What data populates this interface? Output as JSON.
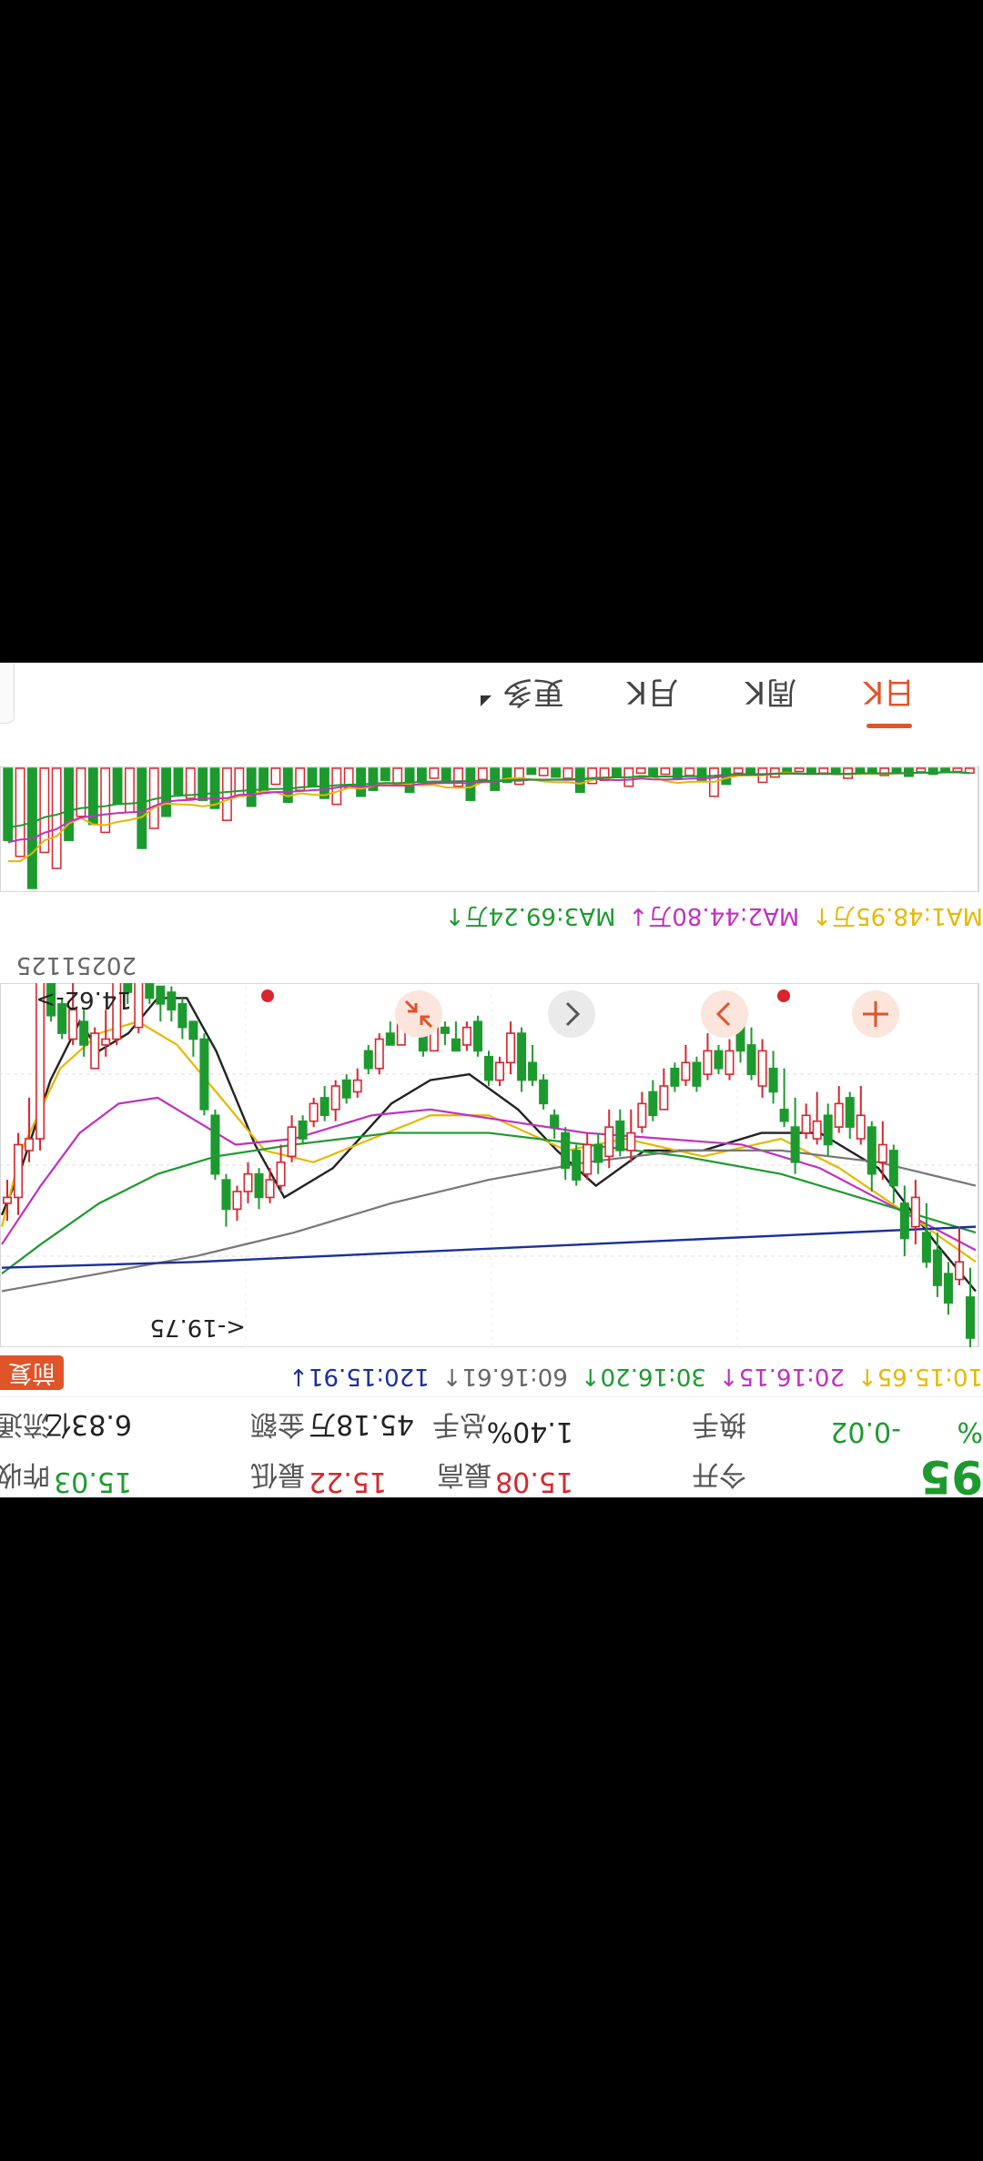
{
  "quote": {
    "price_partial": "95",
    "pct_partial": "%",
    "open_label": "今开",
    "high_label": "最高",
    "high_value": "15.08",
    "low_label": "最低",
    "low_value": "15.22",
    "prev_label_partial": "昨收",
    "prev_value": "15.03",
    "change_value": "-0.02",
    "turnover_label": "换手",
    "turnover_value": "1.40%",
    "volume_label": "总手",
    "amount_value": "45.18万",
    "amount_label": "金额",
    "mktcap_value": "6.83亿",
    "mktcap_label_partial": "流通"
  },
  "kline": {
    "ma_labels": [
      {
        "text": "10:15.65↑",
        "color": "#e6b800"
      },
      {
        "text": "20:16.15↑",
        "color": "#c030c0"
      },
      {
        "text": "30:16.20↑",
        "color": "#1d9a2e"
      },
      {
        "text": "60:16.61↑",
        "color": "#666666"
      },
      {
        "text": "120:15.91↓",
        "color": "#1a2f9a"
      }
    ],
    "fq_button": "前复",
    "high_marker": "<-19.75",
    "low_marker": "14.62->",
    "date_label": "20251125",
    "buttons": [
      "zoom-in",
      "prev",
      "next",
      "shrink"
    ]
  },
  "volume": {
    "ma_labels": [
      {
        "text": "MA1:48.95万↑",
        "color": "#e6b800"
      },
      {
        "text": "MA2:44.80万↓",
        "color": "#c030c0"
      },
      {
        "text": "MA3:69.24万↑",
        "color": "#1d9a2e"
      }
    ]
  },
  "tabs": {
    "items": [
      "日K",
      "周K",
      "月K",
      "更多"
    ],
    "active": 0
  },
  "colors": {
    "up": "#d9252e",
    "down": "#1d9a2e",
    "accent": "#e0542a"
  },
  "chart_data": {
    "type": "candlestick",
    "max_marker": 19.75,
    "min_marker": 14.62,
    "ylim": [
      14.3,
      20.2
    ],
    "candles": [
      [
        20.2,
        19.5,
        19.0,
        20.4
      ],
      [
        18.9,
        19.2,
        18.3,
        19.3
      ],
      [
        19.6,
        19.1,
        18.9,
        19.8
      ],
      [
        19.3,
        18.7,
        18.4,
        19.5
      ],
      [
        18.9,
        18.4,
        17.9,
        19.0
      ],
      [
        17.8,
        18.3,
        17.5,
        18.6
      ],
      [
        18.5,
        17.9,
        17.6,
        18.8
      ],
      [
        17.6,
        17.0,
        16.9,
        17.9
      ],
      [
        16.9,
        17.2,
        16.5,
        17.5
      ],
      [
        17.4,
        16.6,
        16.5,
        17.7
      ],
      [
        16.4,
        16.8,
        15.9,
        16.9
      ],
      [
        16.6,
        16.1,
        16.0,
        16.8
      ],
      [
        16.2,
        16.6,
        15.9,
        16.7
      ],
      [
        16.9,
        16.4,
        16.2,
        17.1
      ],
      [
        16.5,
        16.8,
        16.0,
        16.9
      ],
      [
        16.4,
        16.7,
        16.2,
        16.8
      ],
      [
        17.2,
        16.6,
        16.1,
        17.4
      ],
      [
        16.5,
        16.3,
        15.6,
        16.6
      ],
      [
        16.0,
        15.6,
        15.3,
        16.2
      ],
      [
        15.3,
        15.9,
        15.1,
        16.1
      ],
      [
        15.7,
        15.2,
        14.9,
        15.8
      ],
      [
        15.3,
        14.8,
        14.8,
        15.5
      ],
      [
        15.3,
        15.7,
        15.1,
        15.8
      ],
      [
        15.6,
        15.3,
        15.2,
        15.7
      ],
      [
        15.3,
        15.7,
        15.0,
        15.8
      ],
      [
        15.9,
        15.5,
        15.4,
        16.0
      ],
      [
        15.5,
        15.8,
        15.2,
        15.9
      ],
      [
        15.9,
        15.6,
        15.5,
        16.0
      ],
      [
        15.9,
        16.3,
        15.6,
        16.3
      ],
      [
        16.4,
        16.0,
        15.8,
        16.5
      ],
      [
        16.2,
        16.6,
        16.0,
        16.7
      ],
      [
        16.7,
        17.0,
        16.3,
        17.2
      ],
      [
        17.0,
        16.5,
        16.3,
        17.1
      ],
      [
        16.6,
        17.1,
        16.3,
        17.3
      ],
      [
        17.2,
        16.9,
        16.7,
        17.4
      ],
      [
        16.9,
        17.4,
        16.7,
        17.5
      ],
      [
        17.5,
        17.0,
        16.9,
        17.6
      ],
      [
        17.3,
        16.7,
        16.6,
        17.5
      ],
      [
        16.6,
        16.4,
        16.3,
        16.8
      ],
      [
        16.2,
        15.8,
        15.7,
        16.3
      ],
      [
        15.8,
        15.5,
        15.2,
        15.9
      ],
      [
        15.8,
        15.0,
        14.9,
        16.0
      ],
      [
        15.0,
        15.5,
        14.8,
        15.7
      ],
      [
        15.5,
        15.8,
        15.4,
        15.9
      ],
      [
        15.8,
        15.4,
        15.3,
        15.9
      ],
      [
        15.3,
        14.8,
        14.7,
        15.4
      ],
      [
        14.9,
        15.2,
        14.8,
        15.3
      ],
      [
        15.3,
        15.1,
        14.8,
        15.3
      ],
      [
        15.0,
        14.9,
        14.8,
        15.2
      ],
      [
        14.8,
        15.3,
        14.7,
        15.3
      ],
      [
        15.3,
        14.7,
        14.5,
        15.4
      ],
      [
        14.6,
        14.7,
        14.3,
        14.8
      ],
      [
        14.6,
        15.2,
        14.6,
        15.2
      ],
      [
        15.2,
        15.0,
        14.8,
        15.2
      ],
      [
        15.1,
        15.6,
        15.0,
        15.7
      ],
      [
        15.6,
        15.3,
        15.2,
        15.7
      ],
      [
        15.8,
        16.0,
        15.6,
        16.1
      ],
      [
        16.1,
        15.8,
        15.7,
        16.2
      ],
      [
        15.9,
        16.3,
        15.8,
        16.5
      ],
      [
        16.4,
        16.1,
        15.9,
        16.5
      ],
      [
        16.2,
        16.5,
        16.1,
        16.6
      ],
      [
        16.8,
        16.5,
        16.4,
        16.9
      ],
      [
        16.6,
        17.1,
        16.4,
        17.2
      ],
      [
        17.2,
        17.6,
        16.9,
        17.7
      ],
      [
        17.5,
        17.8,
        17.3,
        17.9
      ],
      [
        17.8,
        17.4,
        17.3,
        18.0
      ],
      [
        17.4,
        17.7,
        17.2,
        17.9
      ],
      [
        17.7,
        18.0,
        17.6,
        18.2
      ],
      [
        18.0,
        17.5,
        17.4,
        18.3
      ],
      [
        17.4,
        16.4,
        16.3,
        17.5
      ],
      [
        16.3,
        15.1,
        15.0,
        16.4
      ],
      [
        15.1,
        14.8,
        14.8,
        15.4
      ],
      [
        14.9,
        14.5,
        14.4,
        15.1
      ],
      [
        14.6,
        14.3,
        14.2,
        14.8
      ],
      [
        14.5,
        14.2,
        14.2,
        14.8
      ],
      [
        14.4,
        13.5,
        13.4,
        14.5
      ],
      [
        13.4,
        14.9,
        12.8,
        15.0
      ],
      [
        14.3,
        13.3,
        13.2,
        14.5
      ],
      [
        13.7,
        15.1,
        13.6,
        15.2
      ],
      [
        15.1,
        15.2,
        14.6,
        15.4
      ],
      [
        15.0,
        15.6,
        14.9,
        15.6
      ],
      [
        15.2,
        14.8,
        14.6,
        15.4
      ],
      [
        14.6,
        15.1,
        14.0,
        15.2
      ],
      [
        15.0,
        14.5,
        14.4,
        15.1
      ],
      [
        14.7,
        13.7,
        12.9,
        14.8
      ],
      [
        13.9,
        16.8,
        13.8,
        17.0
      ],
      [
        16.8,
        17.0,
        16.1,
        17.2
      ],
      [
        16.9,
        17.8,
        16.7,
        18.1
      ],
      [
        17.8,
        17.9,
        17.5,
        18.2
      ]
    ],
    "volumes": [
      [
        12,
        1
      ],
      [
        8,
        1
      ],
      [
        10,
        0
      ],
      [
        15,
        0
      ],
      [
        9,
        1
      ],
      [
        20,
        0
      ],
      [
        11,
        0
      ],
      [
        18,
        1
      ],
      [
        9,
        0
      ],
      [
        14,
        0
      ],
      [
        25,
        1
      ],
      [
        10,
        0
      ],
      [
        12,
        1
      ],
      [
        13,
        0
      ],
      [
        8,
        1
      ],
      [
        10,
        0
      ],
      [
        22,
        1
      ],
      [
        35,
        1
      ],
      [
        14,
        0
      ],
      [
        12,
        1
      ],
      [
        40,
        0
      ],
      [
        70,
        1
      ],
      [
        30,
        0
      ],
      [
        18,
        1
      ],
      [
        25,
        0
      ],
      [
        15,
        1
      ],
      [
        20,
        0
      ],
      [
        12,
        1
      ],
      [
        45,
        1
      ],
      [
        20,
        0
      ],
      [
        30,
        1
      ],
      [
        38,
        1
      ],
      [
        60,
        0
      ],
      [
        25,
        1
      ],
      [
        22,
        0
      ],
      [
        18,
        1
      ],
      [
        15,
        0
      ],
      [
        40,
        1
      ],
      [
        35,
        0
      ],
      [
        55,
        0
      ],
      [
        28,
        1
      ],
      [
        80,
        0
      ],
      [
        45,
        1
      ],
      [
        30,
        0
      ],
      [
        25,
        1
      ],
      [
        35,
        0
      ],
      [
        60,
        0
      ],
      [
        40,
        1
      ],
      [
        30,
        0
      ],
      [
        55,
        0
      ],
      [
        70,
        0
      ],
      [
        48,
        1
      ],
      [
        90,
        1
      ],
      [
        75,
        0
      ],
      [
        45,
        0
      ],
      [
        55,
        1
      ],
      [
        85,
        0
      ],
      [
        40,
        1
      ],
      [
        60,
        0
      ],
      [
        95,
        0
      ],
      [
        70,
        1
      ],
      [
        130,
        1
      ],
      [
        100,
        0
      ],
      [
        80,
        0
      ],
      [
        75,
        1
      ],
      [
        65,
        0
      ],
      [
        120,
        0
      ],
      [
        150,
        1
      ],
      [
        200,
        0
      ],
      [
        110,
        1
      ],
      [
        90,
        0
      ],
      [
        160,
        1
      ],
      [
        140,
        0
      ],
      [
        120,
        1
      ],
      [
        180,
        0
      ],
      [
        250,
        1
      ],
      [
        210,
        1
      ],
      [
        300,
        0
      ],
      [
        220,
        1
      ],
      [
        180,
        0
      ]
    ],
    "ma_lines": [
      {
        "color": "#222222",
        "width": 2.4,
        "pts": [
          [
            0,
            19.4
          ],
          [
            0.04,
            18.6
          ],
          [
            0.1,
            17.3
          ],
          [
            0.16,
            16.7
          ],
          [
            0.22,
            16.7
          ],
          [
            0.28,
            17.0
          ],
          [
            0.34,
            17.0
          ],
          [
            0.39,
            17.6
          ],
          [
            0.43,
            17.0
          ],
          [
            0.47,
            16.3
          ],
          [
            0.52,
            15.7
          ],
          [
            0.56,
            15.8
          ],
          [
            0.6,
            16.2
          ],
          [
            0.66,
            17.3
          ],
          [
            0.71,
            17.8
          ],
          [
            0.74,
            16.9
          ],
          [
            0.78,
            15.3
          ],
          [
            0.81,
            14.4
          ],
          [
            0.84,
            14.4
          ],
          [
            0.87,
            15.0
          ],
          [
            0.9,
            15.3
          ],
          [
            0.92,
            14.8
          ],
          [
            0.95,
            15.8
          ],
          [
            0.98,
            17.3
          ],
          [
            1,
            18.1
          ]
        ]
      },
      {
        "color": "#e6b800",
        "width": 2.2,
        "pts": [
          [
            0,
            18.9
          ],
          [
            0.06,
            18.2
          ],
          [
            0.14,
            17.3
          ],
          [
            0.2,
            16.8
          ],
          [
            0.28,
            17.1
          ],
          [
            0.36,
            16.8
          ],
          [
            0.42,
            17.0
          ],
          [
            0.5,
            16.4
          ],
          [
            0.56,
            16.4
          ],
          [
            0.62,
            16.8
          ],
          [
            0.68,
            17.2
          ],
          [
            0.73,
            17.0
          ],
          [
            0.78,
            16.0
          ],
          [
            0.82,
            15.2
          ],
          [
            0.86,
            14.8
          ],
          [
            0.9,
            15.0
          ],
          [
            0.94,
            15.6
          ],
          [
            0.98,
            17.0
          ],
          [
            1,
            18.3
          ]
        ]
      },
      {
        "color": "#c030c0",
        "width": 2.2,
        "pts": [
          [
            0,
            18.7
          ],
          [
            0.08,
            18.0
          ],
          [
            0.16,
            17.3
          ],
          [
            0.24,
            16.9
          ],
          [
            0.32,
            16.8
          ],
          [
            0.4,
            16.7
          ],
          [
            0.48,
            16.5
          ],
          [
            0.56,
            16.3
          ],
          [
            0.62,
            16.4
          ],
          [
            0.7,
            16.8
          ],
          [
            0.76,
            16.9
          ],
          [
            0.8,
            16.5
          ],
          [
            0.84,
            16.1
          ],
          [
            0.88,
            16.2
          ],
          [
            0.92,
            16.7
          ],
          [
            0.96,
            17.6
          ],
          [
            1,
            18.6
          ]
        ]
      },
      {
        "color": "#1d9a2e",
        "width": 2.2,
        "pts": [
          [
            0,
            18.4
          ],
          [
            0.1,
            17.9
          ],
          [
            0.2,
            17.4
          ],
          [
            0.3,
            17.1
          ],
          [
            0.4,
            16.9
          ],
          [
            0.5,
            16.7
          ],
          [
            0.6,
            16.7
          ],
          [
            0.7,
            16.9
          ],
          [
            0.78,
            17.1
          ],
          [
            0.84,
            17.4
          ],
          [
            0.9,
            17.9
          ],
          [
            0.96,
            18.6
          ],
          [
            1,
            19.1
          ]
        ]
      },
      {
        "color": "#777777",
        "width": 2.2,
        "pts": [
          [
            0,
            17.6
          ],
          [
            0.1,
            17.2
          ],
          [
            0.2,
            17.0
          ],
          [
            0.3,
            17.0
          ],
          [
            0.4,
            17.2
          ],
          [
            0.5,
            17.5
          ],
          [
            0.6,
            17.9
          ],
          [
            0.7,
            18.4
          ],
          [
            0.8,
            18.8
          ],
          [
            0.9,
            19.1
          ],
          [
            1,
            19.4
          ]
        ]
      },
      {
        "color": "#1a2f9a",
        "width": 2.4,
        "pts": [
          [
            0,
            18.3
          ],
          [
            0.2,
            18.45
          ],
          [
            0.4,
            18.6
          ],
          [
            0.6,
            18.75
          ],
          [
            0.8,
            18.9
          ],
          [
            1,
            19.0
          ]
        ]
      }
    ]
  }
}
